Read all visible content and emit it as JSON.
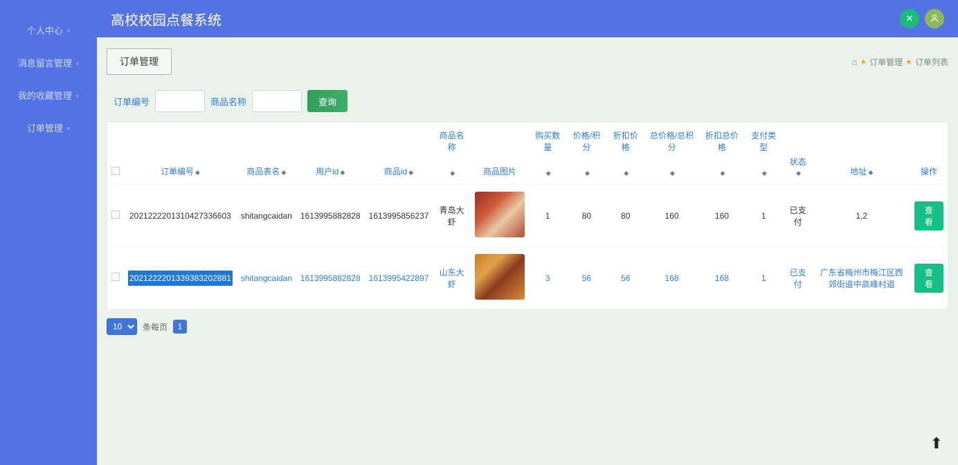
{
  "header": {
    "title": "高校校园点餐系统"
  },
  "sidebar": {
    "items": [
      {
        "label": "个人中心"
      },
      {
        "label": "消息留言管理"
      },
      {
        "label": "我的收藏管理"
      },
      {
        "label": "订单管理"
      }
    ]
  },
  "tab": {
    "label": "订单管理"
  },
  "breadcrumb": {
    "a": "订单管理",
    "b": "订单列表"
  },
  "filter": {
    "order_no_label": "订单编号",
    "product_name_label": "商品名称",
    "query_label": "查询"
  },
  "table": {
    "headers": {
      "order_no": "订单编号",
      "table_name": "商品表名",
      "user_id": "用户id",
      "product_id": "商品id",
      "product_name": "商品名称",
      "product_img": "商品图片",
      "qty": "购买数量",
      "price": "价格/积分",
      "discount_price": "折扣价格",
      "total": "总价格/总积分",
      "discount_total": "折扣总价格",
      "pay_type": "支付类型",
      "status": "状态",
      "address": "地址",
      "ops": "操作"
    },
    "rows": [
      {
        "order_no": "2021222201310427336603",
        "table_name": "shitangcaidan",
        "user_id": "1613995882828",
        "product_id": "1613995856237",
        "product_name": "青岛大虾",
        "qty": "1",
        "price": "80",
        "discount_price": "80",
        "total": "160",
        "discount_total": "160",
        "pay_type": "1",
        "status": "已支付",
        "address": "1,2",
        "op": "查看"
      },
      {
        "order_no": "2021222201339383202881",
        "table_name": "shitangcaidan",
        "user_id": "1613995882828",
        "product_id": "1613995422897",
        "product_name": "山东大虾",
        "qty": "3",
        "price": "56",
        "discount_price": "56",
        "total": "168",
        "discount_total": "168",
        "pay_type": "1",
        "status": "已支付",
        "address": "广东省梅州市梅江区西郊街道中高峰村道",
        "op": "查看"
      }
    ]
  },
  "pager": {
    "size": "10",
    "per": "条每页",
    "page": "1"
  }
}
